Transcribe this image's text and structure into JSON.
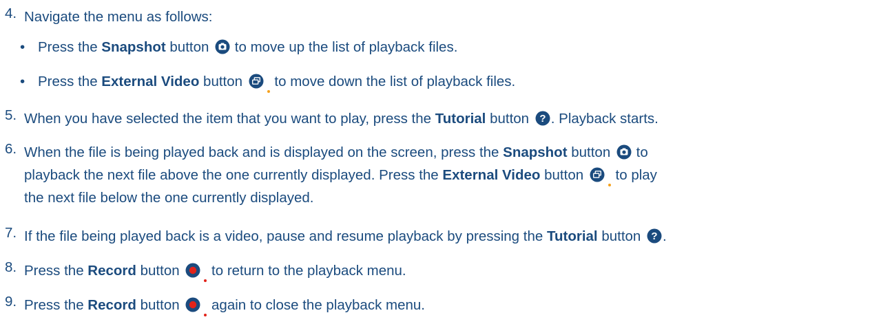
{
  "steps": [
    {
      "number": "4.",
      "parts": [
        {
          "t": "Navigate the menu as follows:"
        }
      ]
    },
    {
      "number": "5.",
      "parts": [
        {
          "t": "When you have selected the item that you want to play, press the "
        },
        {
          "b": "Tutorial"
        },
        {
          "t": " button "
        },
        {
          "icon": "tutorial"
        },
        {
          "t": ". Playback starts."
        }
      ]
    },
    {
      "number": "6.",
      "lines": [
        [
          {
            "t": "When the file is being played back and is displayed on the screen, press the "
          },
          {
            "b": "Snapshot"
          },
          {
            "t": " button "
          },
          {
            "icon": "snapshot"
          },
          {
            "t": " to"
          }
        ],
        [
          {
            "t": "playback the next file above the one currently displayed. Press the "
          },
          {
            "b": "External Video"
          },
          {
            "t": " button "
          },
          {
            "icon": "external-video"
          },
          {
            "t": " to play"
          }
        ],
        [
          {
            "t": "the next file below the one currently displayed."
          }
        ]
      ]
    },
    {
      "number": "7.",
      "parts": [
        {
          "t": "If the file being played back is a video, pause and resume playback by pressing the "
        },
        {
          "b": "Tutorial"
        },
        {
          "t": " button "
        },
        {
          "icon": "tutorial"
        },
        {
          "t": "."
        }
      ]
    },
    {
      "number": "8.",
      "parts": [
        {
          "t": "Press the "
        },
        {
          "b": "Record"
        },
        {
          "t": " button "
        },
        {
          "icon": "record"
        },
        {
          "t": " to return to the playback menu."
        }
      ]
    },
    {
      "number": "9.",
      "parts": [
        {
          "t": "Press the "
        },
        {
          "b": "Record"
        },
        {
          "t": " button "
        },
        {
          "icon": "record"
        },
        {
          "t": " again to close the playback menu."
        }
      ]
    }
  ],
  "bullets": [
    {
      "parts": [
        {
          "t": "Press the "
        },
        {
          "b": "Snapshot"
        },
        {
          "t": " button "
        },
        {
          "icon": "snapshot"
        },
        {
          "t": " to move up the list of playback files."
        }
      ]
    },
    {
      "parts": [
        {
          "t": "Press the "
        },
        {
          "b": "External Video"
        },
        {
          "t": " button "
        },
        {
          "icon": "external-video"
        },
        {
          "t": " to move down the list of playback files."
        }
      ]
    }
  ],
  "bullet_glyph": "•",
  "colors": {
    "text": "#1b4b7e",
    "icon_fill": "#1b4b7e",
    "record_fill": "#e2231a",
    "tick_orange": "#f5a11c",
    "tick_red": "#e2231a"
  }
}
